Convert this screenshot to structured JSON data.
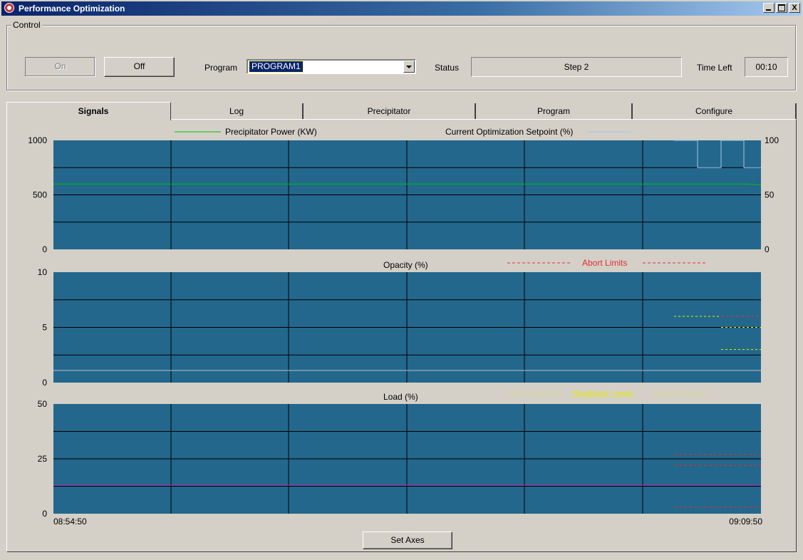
{
  "window": {
    "title": "Performance Optimization",
    "min_glyph": "_",
    "max_glyph": "□",
    "close_glyph": "X"
  },
  "control": {
    "group_label": "Control",
    "on_label": "On",
    "off_label": "Off",
    "program_label": "Program",
    "program_value": "PROGRAM1",
    "status_label": "Status",
    "status_value": "Step 2",
    "time_left_label": "Time Left",
    "time_left_value": "00:10"
  },
  "tabs": [
    {
      "label": "Signals",
      "active": true
    },
    {
      "label": "Log",
      "active": false
    },
    {
      "label": "Precipitator",
      "active": false
    },
    {
      "label": "Program",
      "active": false
    },
    {
      "label": "Configure",
      "active": false
    }
  ],
  "legend": {
    "precipitator_power": "Precipitator Power (KW)",
    "setpoint": "Current Optimization Setpoint (%)",
    "opacity": "Opacity (%)",
    "abort_limits": "Abort Limits",
    "load": "Load (%)",
    "stepback_limits": "StepBack Limits"
  },
  "footer": {
    "set_axes": "Set Axes"
  },
  "colors": {
    "plot_bg": "#23678c",
    "power_line": "#00c000",
    "setpoint_line": "#a0c8e8",
    "abort": "#e03030",
    "stepback": "#e8e800",
    "load_line": "#c020c0",
    "opacity_line": "#c0c0c0"
  },
  "chart_data": [
    {
      "type": "line",
      "x": [
        "08:54:50",
        "09:09:50"
      ],
      "ylim_left": [
        0,
        1000
      ],
      "left_ticks": [
        "1000",
        "500",
        "0"
      ],
      "ylim_right": [
        0,
        100
      ],
      "right_ticks": [
        "100",
        "50",
        "0"
      ],
      "series": [
        {
          "name": "Precipitator Power (KW)",
          "axis": "left",
          "values": [
            600,
            600,
            590
          ]
        },
        {
          "name": "Current Optimization Setpoint (%)",
          "axis": "right",
          "step": true,
          "values": [
            100,
            100,
            75,
            100,
            75
          ]
        }
      ]
    },
    {
      "type": "line",
      "ylim": [
        0,
        10
      ],
      "ticks": [
        "10",
        "5",
        "0"
      ],
      "series": [
        {
          "name": "Opacity (%)",
          "values": [
            1.1,
            1.1
          ]
        },
        {
          "name": "Abort Limits",
          "values": [
            6,
            5
          ]
        },
        {
          "name": "StepBack Limits",
          "values": [
            6,
            5,
            3
          ]
        }
      ]
    },
    {
      "type": "line",
      "ylim": [
        0,
        50
      ],
      "ticks": [
        "50",
        "25",
        "0"
      ],
      "x_start": "08:54:50",
      "x_end": "09:09:50",
      "series": [
        {
          "name": "Load (%)",
          "values": [
            13,
            13
          ]
        },
        {
          "name": "Abort Limits",
          "values": [
            27,
            22,
            3
          ]
        }
      ]
    }
  ]
}
